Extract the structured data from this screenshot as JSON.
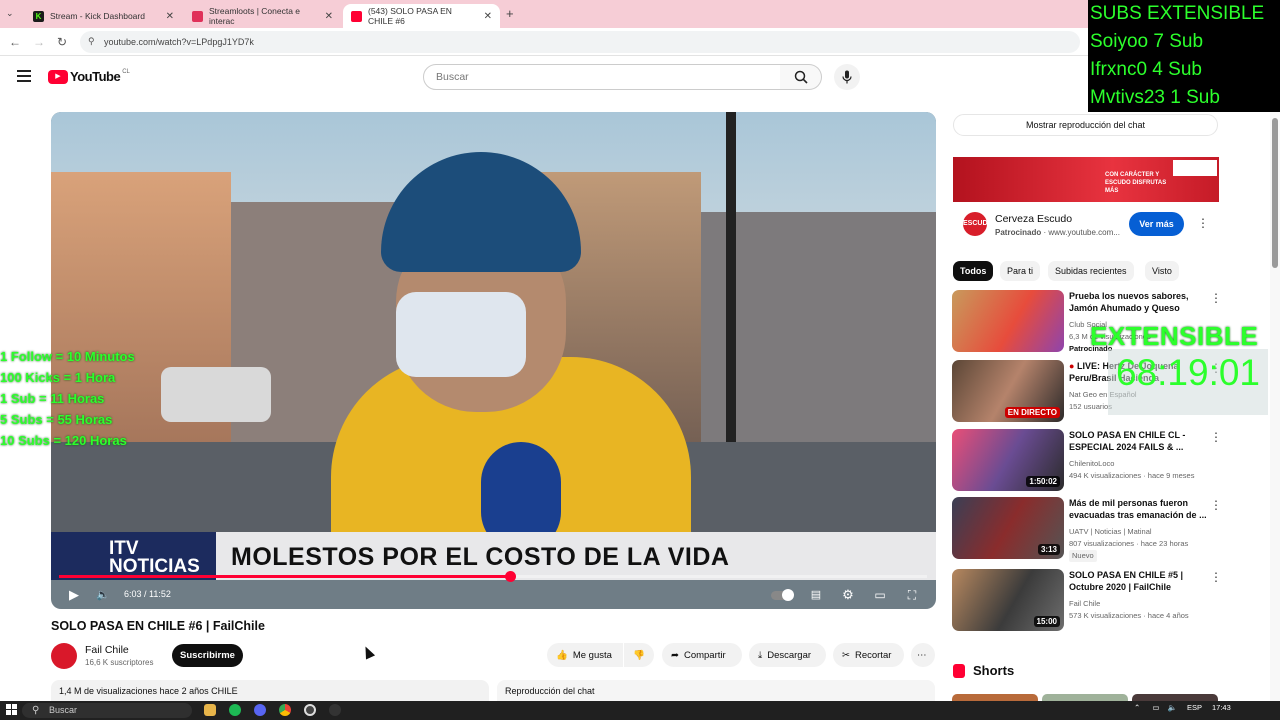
{
  "browser": {
    "tabs": [
      {
        "label": "Stream - Kick Dashboard",
        "color": "#53fc18"
      },
      {
        "label": "Streamloots | Conecta e interac",
        "color": "#e0315a"
      },
      {
        "label": "(543) SOLO PASA EN CHILE #6",
        "color": "#ff0033"
      }
    ],
    "new_tab": "+",
    "url": "youtube.com/watch?v=LPdpgJ1YD7k"
  },
  "youtube": {
    "logo_text": "YouTube",
    "logo_country": "CL",
    "search_placeholder": "Buscar"
  },
  "video": {
    "lower_third_logo": "ITV\nNOTICIAS",
    "lower_third_text": "MOLESTOS POR EL COSTO DE LA VIDA",
    "time": "6:03 / 11:52",
    "progress": 0.52
  },
  "overlay": {
    "rules": [
      "1 Follow = 10 Minutos",
      "100 Kicks = 1 Hora",
      "1 Sub = 11 Horas",
      "5 Subs = 55 Horas",
      "10 Subs = 120 Horas"
    ],
    "subs_lines": [
      "SUBS EXTENSIBLE",
      "Soiyoo 7 Sub",
      "Ifrxnc0 4 Sub",
      "Mvtivs23 1 Sub"
    ],
    "extensible_label": "EXTENSIBLE",
    "extensible_timer": "68:19:01"
  },
  "watch": {
    "title": "SOLO PASA EN CHILE #6 | FailChile",
    "channel": "Fail Chile",
    "subscribers": "16,6 K suscriptores",
    "subscribe": "Suscribirme",
    "like": "Me gusta",
    "share": "Compartir",
    "download": "Descargar",
    "clip": "Recortar",
    "description": "1,4 M de visualizaciones  hace 2 años  CHILE",
    "chat_replay": "Reproducción del chat"
  },
  "sidebar": {
    "chat_button": "Mostrar reproducción del chat",
    "ad": {
      "title": "Cerveza Escudo",
      "sponsor": "Patrocinado",
      "domain": "www.youtube.com...",
      "cta": "Ver más",
      "logo": "ESCUDO",
      "banner_text": "CON CARÁCTER Y ESCUDO DISFRUTAS MÁS"
    },
    "chips": [
      "Todos",
      "Para ti",
      "Subidas recientes",
      "Visto"
    ],
    "recommendations": [
      {
        "title": "Prueba los nuevos sabores, Jamón Ahumado y Queso",
        "channel": "Club Social",
        "meta": "6,3 M de visualizaciones",
        "badge": "Patrocinado",
        "duration": ""
      },
      {
        "title": "LIVE: Hertz De Joquena Peru/Brasil Hacienda",
        "channel": "Nat Geo en Español",
        "meta": "152 usuarios",
        "badge": "",
        "duration": "EN DIRECTO"
      },
      {
        "title": "SOLO PASA EN CHILE CL - ESPECIAL 2024 FAILS & ...",
        "channel": "ChilenitoLoco",
        "meta": "494 K visualizaciones · hace 9 meses",
        "badge": "",
        "duration": "1:50:02"
      },
      {
        "title": "Más de mil personas fueron evacuadas tras emanación de ...",
        "channel": "UATV | Noticias | Matinal",
        "meta": "807 visualizaciones · hace 23 horas",
        "badge": "Nuevo",
        "duration": "3:13"
      },
      {
        "title": "SOLO PASA EN CHILE #5 | Octubre 2020 | FailChile",
        "channel": "Fail Chile",
        "meta": "573 K visualizaciones · hace 4 años",
        "badge": "",
        "duration": "15:00"
      }
    ],
    "shorts": "Shorts"
  },
  "taskbar": {
    "search": "Buscar",
    "lang": "ESP",
    "time": "17:43"
  }
}
